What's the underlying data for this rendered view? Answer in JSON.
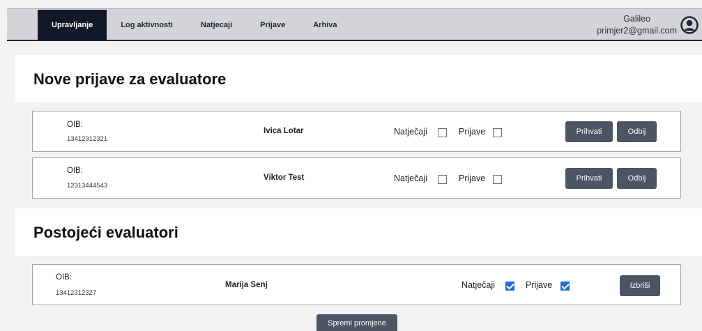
{
  "nav": {
    "items": [
      {
        "label": "Upravljanje",
        "active": true
      },
      {
        "label": "Log aktivnosti",
        "active": false
      },
      {
        "label": "Natjecaji",
        "active": false
      },
      {
        "label": "Prijave",
        "active": false
      },
      {
        "label": "Arhiva",
        "active": false
      }
    ]
  },
  "user": {
    "name": "Galileo",
    "email": "primjer2@gmail.com",
    "icon": "user-circle-icon"
  },
  "new_section": {
    "title": "Nove prijave za evaluatore",
    "rows": [
      {
        "oib_label": "OIB:",
        "oib": "13412312321",
        "name": "Ivica Lotar",
        "natjecaji_label": "Natječaji",
        "natjecaji_checked": false,
        "prijave_label": "Prijave",
        "prijave_checked": false,
        "accept_label": "Prihvati",
        "reject_label": "Odbij"
      },
      {
        "oib_label": "OIB:",
        "oib": "12313444543",
        "name": "Viktor Test",
        "natjecaji_label": "Natječaji",
        "natjecaji_checked": false,
        "prijave_label": "Prijave",
        "prijave_checked": false,
        "accept_label": "Prihvati",
        "reject_label": "Odbij"
      }
    ]
  },
  "existing_section": {
    "title": "Postojeći evaluatori",
    "rows": [
      {
        "oib_label": "OIB:",
        "oib": "13412312327",
        "name": "Marija Senj",
        "natjecaji_label": "Natječaji",
        "natjecaji_checked": true,
        "prijave_label": "Prijave",
        "prijave_checked": true,
        "delete_label": "Izbriši"
      }
    ]
  },
  "save_label": "Spremi promjene",
  "colors": {
    "active_nav": "#111827",
    "button": "#4b5563",
    "checkbox_checked": "#1d6fd8"
  }
}
